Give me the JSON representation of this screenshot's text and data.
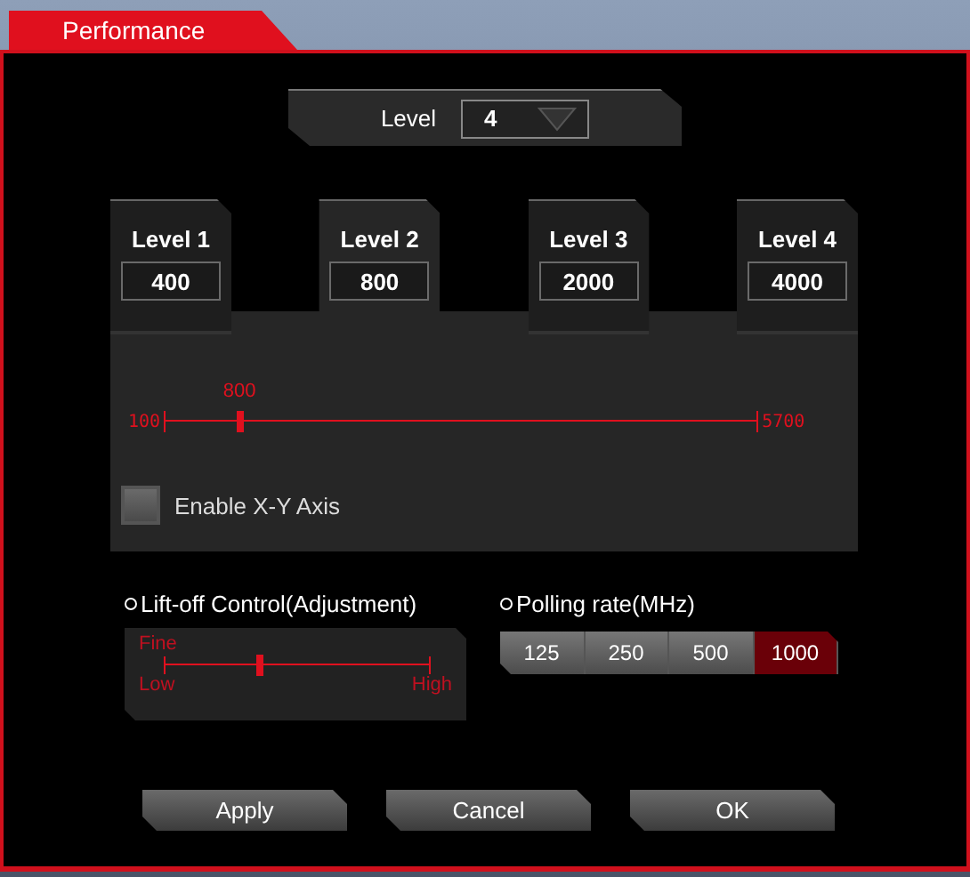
{
  "window": {
    "title": "Performance"
  },
  "level_select": {
    "label": "Level",
    "value": "4"
  },
  "levels": [
    {
      "label": "Level 1",
      "value": "400",
      "selected": false
    },
    {
      "label": "Level 2",
      "value": "800",
      "selected": true
    },
    {
      "label": "Level 3",
      "value": "2000",
      "selected": false
    },
    {
      "label": "Level 4",
      "value": "4000",
      "selected": false
    }
  ],
  "dpi_slider": {
    "min_label": "100",
    "max_label": "5700",
    "reading": "800",
    "level": 0.125
  },
  "xy_axis": {
    "label": "Enable X-Y Axis",
    "checked": false
  },
  "lift_off": {
    "title": "Lift-off Control(Adjustment)",
    "top_label": "Fine",
    "low_label": "Low",
    "high_label": "High",
    "level": 0.36
  },
  "polling": {
    "title": "Polling rate(MHz)",
    "options": [
      {
        "label": "125",
        "selected": false
      },
      {
        "label": "250",
        "selected": false
      },
      {
        "label": "500",
        "selected": false
      },
      {
        "label": "1000",
        "selected": true
      }
    ]
  },
  "buttons": [
    "Apply",
    "Cancel",
    "OK"
  ]
}
